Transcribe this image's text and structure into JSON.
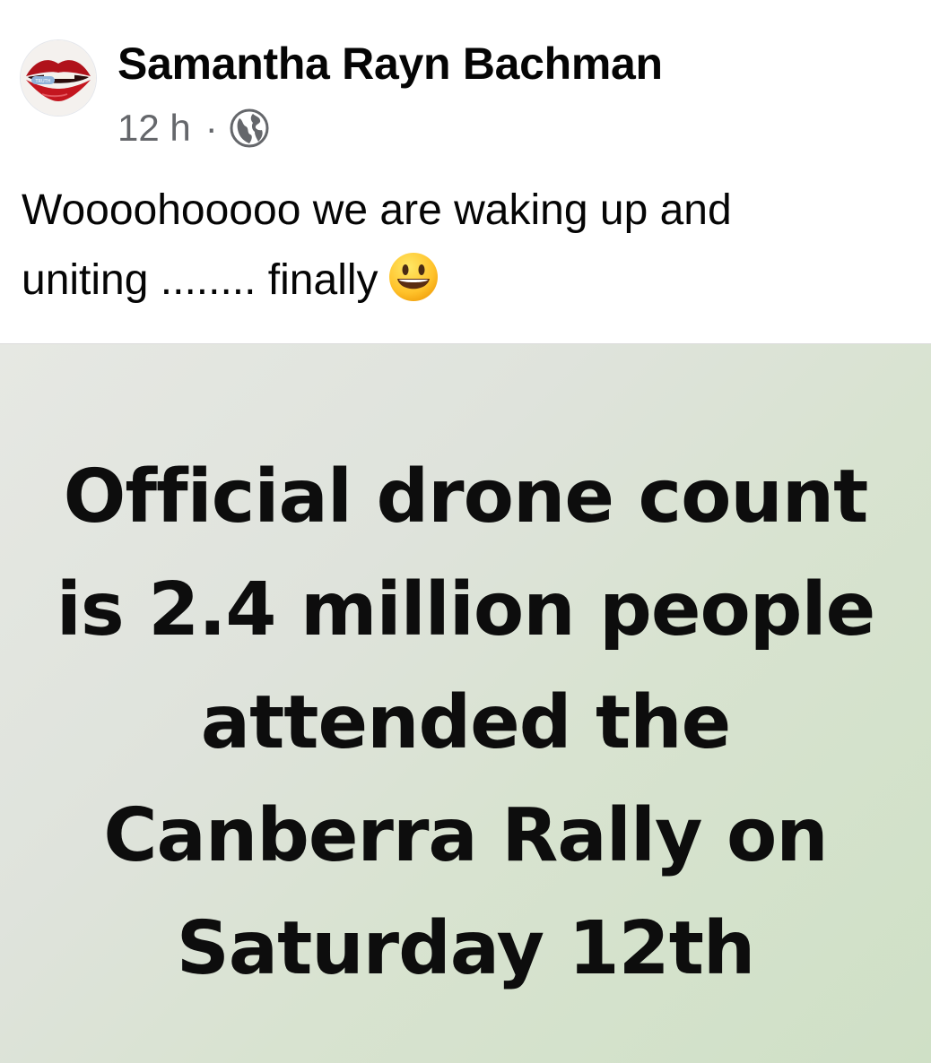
{
  "post": {
    "author": {
      "name": "Samantha Rayn Bachman",
      "avatar_icon": "avatar-lips-icon"
    },
    "meta": {
      "time": "12 h",
      "separator": "·",
      "privacy_icon": "globe-icon"
    },
    "caption": {
      "line1": "Woooohooooo we are waking up and",
      "line2": "uniting ........ finally",
      "emoji": "smiley-emoji"
    },
    "image": {
      "lines": [
        "Official drone count",
        "is 2.4 million people",
        "attended the",
        "Canberra Rally on",
        "Saturday 12th"
      ]
    }
  },
  "colors": {
    "text_primary": "#050505",
    "text_secondary": "#65676b",
    "image_background": "#dfe3dc",
    "image_text": "#0d0d0d"
  }
}
